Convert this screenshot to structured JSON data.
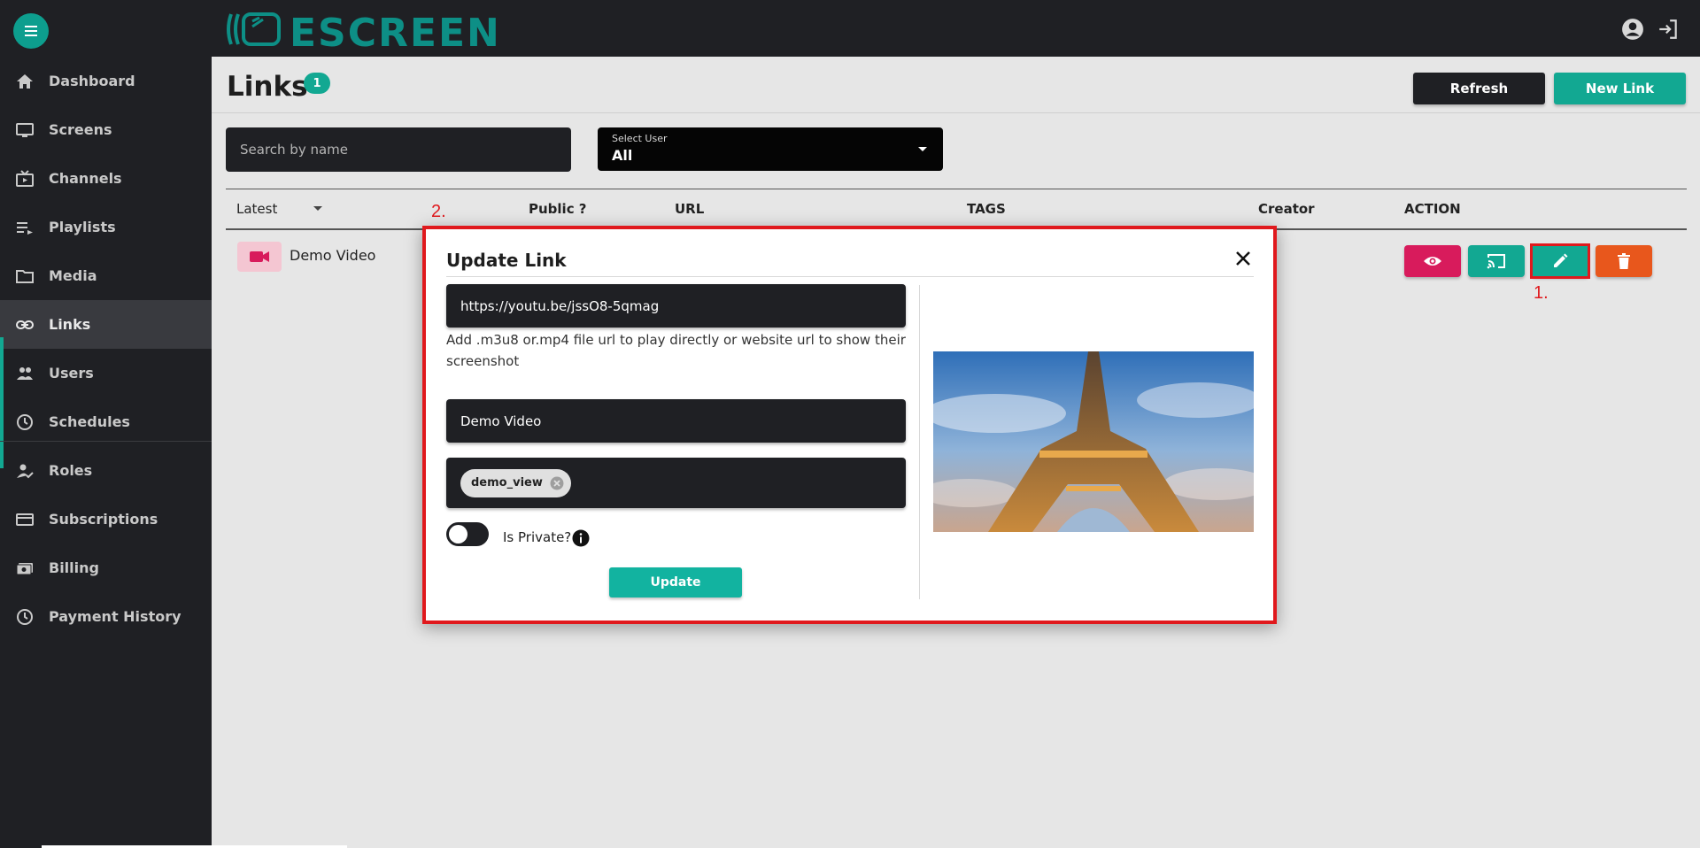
{
  "app": {
    "logo_text": "ESCREEN"
  },
  "sidebar": {
    "items": [
      {
        "label": "Dashboard",
        "icon": "home-icon"
      },
      {
        "label": "Screens",
        "icon": "monitor-icon"
      },
      {
        "label": "Channels",
        "icon": "tv-icon"
      },
      {
        "label": "Playlists",
        "icon": "playlist-icon"
      },
      {
        "label": "Media",
        "icon": "folder-icon"
      },
      {
        "label": "Links",
        "icon": "link-icon",
        "active": true
      },
      {
        "label": "Users",
        "icon": "users-icon"
      },
      {
        "label": "Schedules",
        "icon": "clock-icon"
      },
      {
        "label": "Roles",
        "icon": "user-check-icon"
      },
      {
        "label": "Subscriptions",
        "icon": "card-icon"
      },
      {
        "label": "Billing",
        "icon": "billing-icon"
      },
      {
        "label": "Payment History",
        "icon": "history-icon"
      }
    ]
  },
  "page": {
    "title": "Links",
    "count": "1"
  },
  "toolbar": {
    "refresh_label": "Refresh",
    "new_link_label": "New Link"
  },
  "filters": {
    "search_placeholder": "Search by name",
    "user_select_label": "Select User",
    "user_select_value": "All"
  },
  "table": {
    "sort_label": "Latest",
    "columns": [
      "Public ?",
      "URL",
      "TAGS",
      "Creator",
      "ACTION"
    ],
    "rows": [
      {
        "name": "Demo Video"
      }
    ]
  },
  "annotations": {
    "step1": "1.",
    "step2": "2."
  },
  "modal": {
    "title": "Update Link",
    "url_value": "https://youtu.be/jssO8-5qmag",
    "helper_text": "Add .m3u8 or.mp4 file url to play directly or website url to show their screenshot",
    "name_value": "Demo Video",
    "tags": [
      "demo_view"
    ],
    "private_label": "Is Private?",
    "private_on": false,
    "update_label": "Update"
  },
  "colors": {
    "accent": "#12a892",
    "dark": "#1f2024",
    "danger": "#d81b5c",
    "delete": "#e8571c",
    "annotation": "#e0191d"
  }
}
